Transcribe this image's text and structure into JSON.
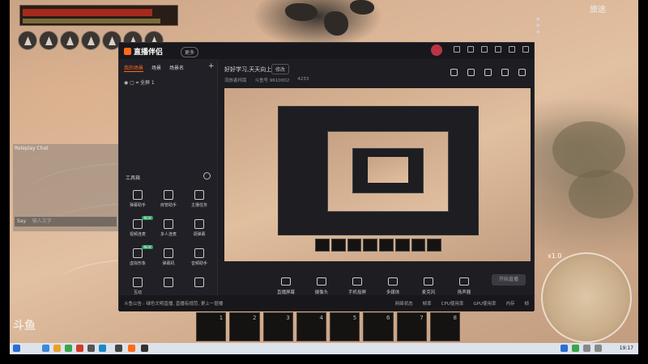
{
  "game": {
    "zone_title": "旅途",
    "chat": {
      "title": "Roleplay Chat",
      "input_channel": "Say",
      "input_placeholder": "输入文字"
    },
    "hotbar_slots": [
      "1",
      "2",
      "3",
      "4",
      "5",
      "6",
      "7",
      "8"
    ],
    "minimap_zoom": "x1.0",
    "watermark": "斗鱼"
  },
  "app": {
    "name": "直播伴侣",
    "tag": "更多",
    "window_controls": [
      "menu-icon",
      "minimize-icon",
      "maximize-icon",
      "close-icon"
    ],
    "scene_tabs": [
      {
        "label": "我的场景",
        "active": true
      },
      {
        "label": "场景",
        "active": false
      },
      {
        "label": "场景名",
        "active": false
      }
    ],
    "scene_item": "全屏 1",
    "tools_title": "工具箱",
    "tools": [
      {
        "label": "弹幕助手",
        "badge": ""
      },
      {
        "label": "房管助手",
        "badge": ""
      },
      {
        "label": "主播任务",
        "badge": ""
      },
      {
        "label": "视频连麦",
        "badge": "NEW"
      },
      {
        "label": "多人连麦",
        "badge": ""
      },
      {
        "label": "调弹幕",
        "badge": ""
      },
      {
        "label": "虚拟形象",
        "badge": "NEW"
      },
      {
        "label": "弹幕机",
        "badge": ""
      },
      {
        "label": "音频助手",
        "badge": ""
      },
      {
        "label": "互动",
        "badge": ""
      },
      {
        "label": "",
        "badge": ""
      },
      {
        "label": "",
        "badge": ""
      }
    ],
    "stream": {
      "title": "好好学习,天天向上",
      "edit_label": "修改",
      "category": "流放者柯南",
      "meta_id": "斗鱼号 9610002",
      "heat": "4233"
    },
    "actions": [
      "直播屏幕",
      "摄像头",
      "手机投屏",
      "多媒体",
      "麦克风",
      "扬声器"
    ],
    "start_label": "开始直播",
    "notice": "斗鱼公告 : 绿色文明直播, 直播有规范, 更上一层楼",
    "stats": [
      "网络状态",
      "帧率",
      "CPU使用率",
      "GPU使用率",
      "内存",
      "帧"
    ]
  },
  "taskbar": {
    "clock": "19:17"
  }
}
